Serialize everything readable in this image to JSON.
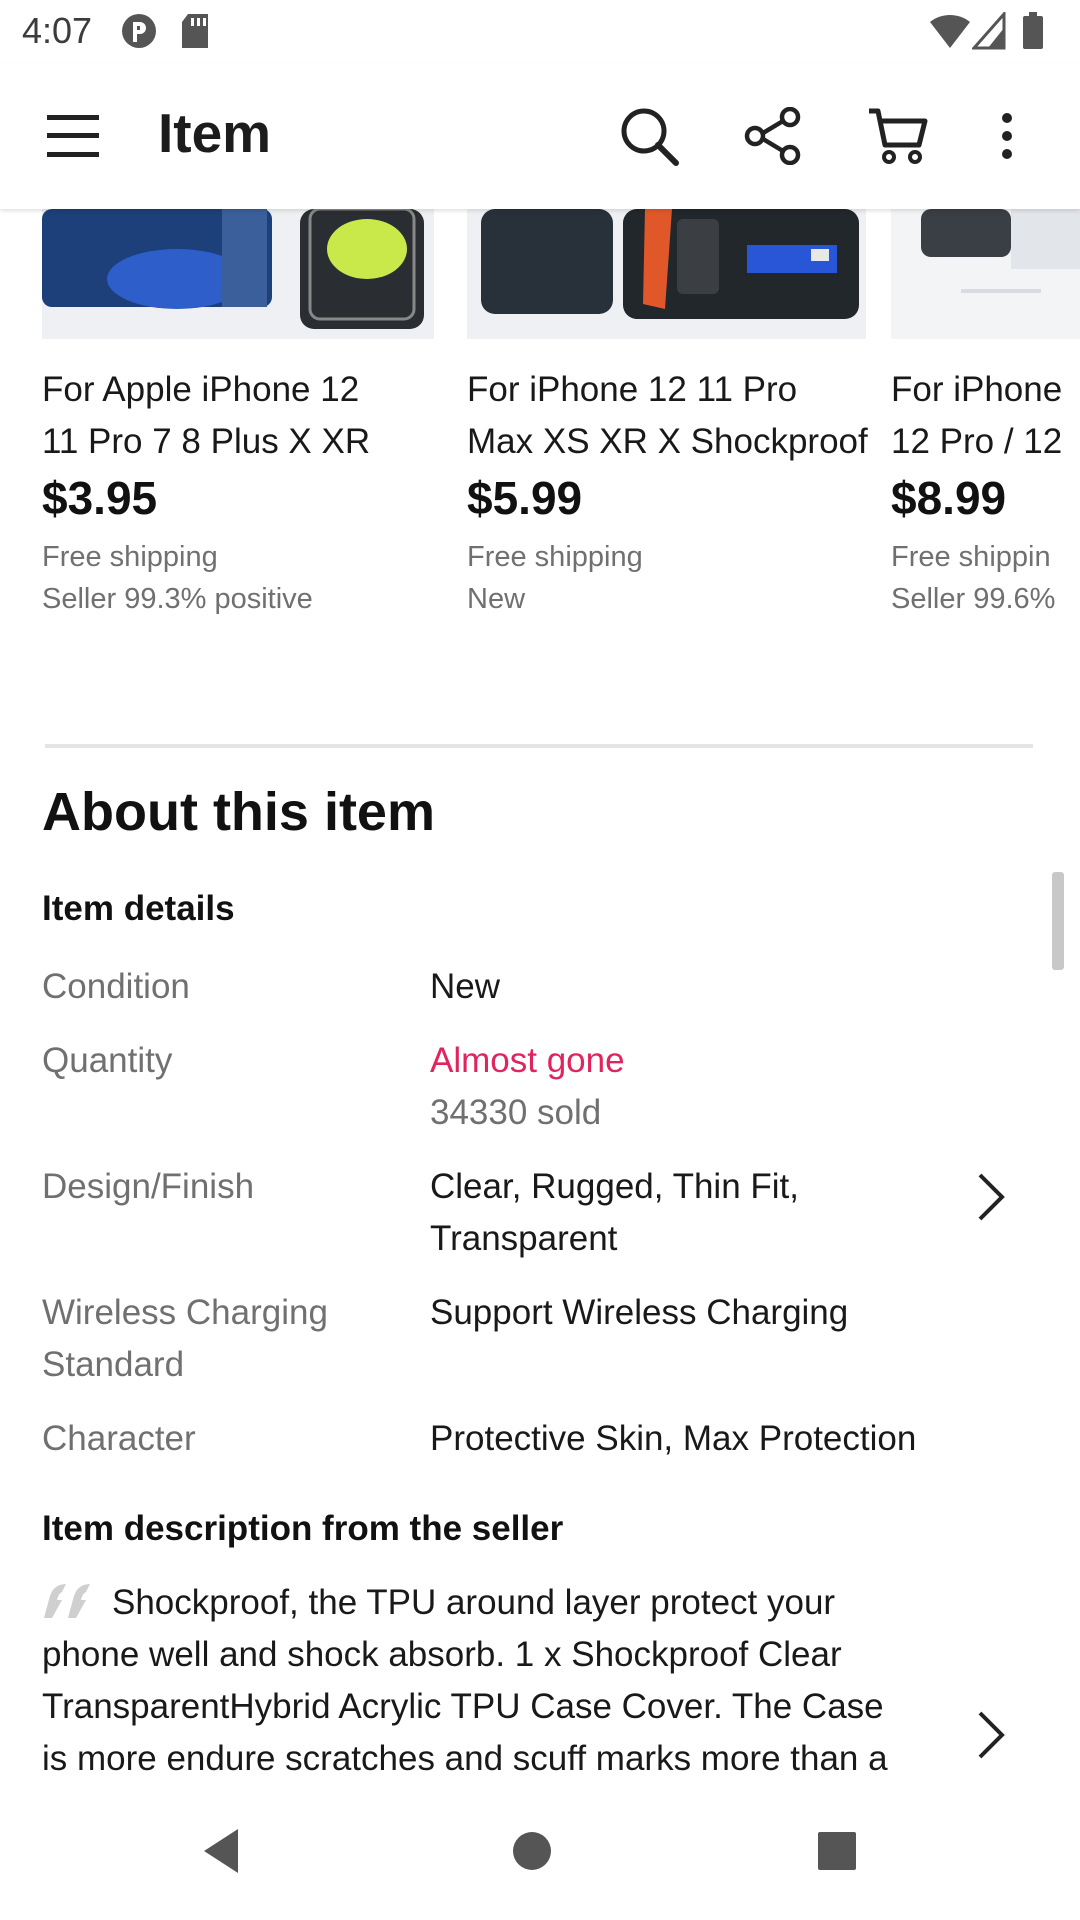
{
  "status_bar": {
    "time": "4:07",
    "icons": [
      "app-notification-icon",
      "sd-card-icon",
      "wifi-icon",
      "signal-icon",
      "battery-icon"
    ]
  },
  "app_bar": {
    "title": "Item",
    "actions": [
      "menu-icon",
      "search-icon",
      "share-icon",
      "cart-icon",
      "more-vert-icon"
    ]
  },
  "similar_items": [
    {
      "title_line1": "For Apple iPhone 12",
      "title_line2": "11 Pro 7 8 Plus X XR",
      "price": "$3.95",
      "shipping": "Free shipping",
      "extra": "Seller 99.3% positive"
    },
    {
      "title_line1": "For iPhone 12 11 Pro",
      "title_line2": "Max XS XR X Shockproof",
      "price": "$5.99",
      "shipping": "Free shipping",
      "extra": "New"
    },
    {
      "title_line1": "For iPhone",
      "title_line2": "12 Pro / 12",
      "price": "$8.99",
      "shipping": "Free shippin",
      "extra": "Seller 99.6%"
    }
  ],
  "about": {
    "title": "About this item",
    "item_details_title": "Item details",
    "rows": [
      {
        "label": "Condition",
        "value": "New"
      },
      {
        "label": "Quantity",
        "value": "Almost gone",
        "value2": "34330 sold"
      },
      {
        "label": "Design/Finish",
        "value": "Clear, Rugged, Thin Fit,",
        "value2": "Transparent"
      },
      {
        "label": "Wireless Charging",
        "label2": "Standard",
        "value": "Support Wireless Charging"
      },
      {
        "label": "Character",
        "value": "Protective Skin, Max Protection"
      }
    ],
    "description_title": "Item description from the seller",
    "description_line1": "Shockproof, the TPU around layer protect your",
    "description_line2": "phone well and shock absorb. 1 x Shockproof Clear",
    "description_line3": "TransparentHybrid Acrylic TPU Case Cover. The Case",
    "description_line4": "is more endure scratches and scuff marks more than a"
  },
  "colors": {
    "accent_red": "#e0245e",
    "secondary_text": "#707070",
    "primary_text": "#191919"
  }
}
